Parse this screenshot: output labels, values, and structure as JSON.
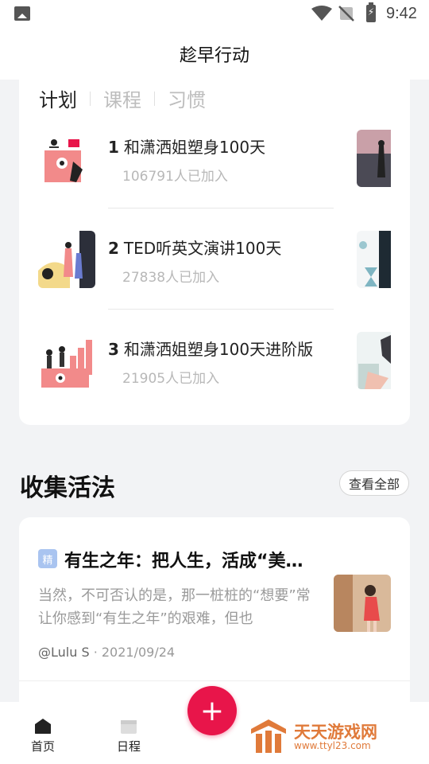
{
  "status_bar": {
    "time": "9:42"
  },
  "header": {
    "title": "趁早行动"
  },
  "plans": {
    "tabs": [
      "计划",
      "课程",
      "习惯"
    ],
    "items": [
      {
        "rank": "1",
        "title": "和潇洒姐塑身100天",
        "joined": "106791人已加入"
      },
      {
        "rank": "2",
        "title": "TED听英文演讲100天",
        "joined": "27838人已加入"
      },
      {
        "rank": "3",
        "title": "和潇洒姐塑身100天进阶版",
        "joined": "21905人已加入"
      }
    ]
  },
  "section": {
    "title": "收集活法",
    "view_all": "查看全部"
  },
  "article": {
    "badge": "精",
    "title": "有生之年：把人生，活成“美…",
    "excerpt": "当然，不可否认的是，那一桩桩的“想要”常让你感到“有生之年”的艰难，但也",
    "author": "@Lulu S",
    "date": " · 2021/09/24"
  },
  "bottom_nav": {
    "home": "首页",
    "schedule": "日程",
    "add": "+"
  },
  "watermark": {
    "text": "天天游戏网",
    "url": "www.ttyl23.com"
  },
  "colors": {
    "accent": "#e8154a",
    "watermark": "#e07a3a"
  }
}
